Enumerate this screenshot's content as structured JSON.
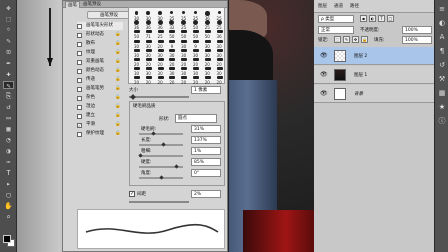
{
  "toolbar": {
    "tools": [
      "move-tool",
      "marquee-tool",
      "lasso-tool",
      "quick-select-tool",
      "crop-tool",
      "eyedropper-tool",
      "healing-tool",
      "brush-tool",
      "clone-stamp-tool",
      "history-brush-tool",
      "eraser-tool",
      "gradient-tool",
      "blur-tool",
      "dodge-tool",
      "pen-tool",
      "type-tool",
      "path-select-tool",
      "shape-tool",
      "hand-tool",
      "zoom-tool"
    ],
    "glyphs": [
      "✥",
      "⬚",
      "ᛜ",
      "✎",
      "⊡",
      "✒",
      "✚",
      "✎",
      "⎘",
      "↺",
      "▭",
      "▦",
      "◔",
      "◑",
      "✑",
      "T",
      "▸",
      "▢",
      "✋",
      "⌕"
    ],
    "active_index": 7
  },
  "brush_panel": {
    "tabs": [
      "画笔",
      "画笔预设"
    ],
    "presets_button": "画笔预设",
    "options": [
      {
        "label": "画笔笔尖形状",
        "checked": false,
        "lock": false
      },
      {
        "label": "形状动态",
        "checked": false,
        "lock": true
      },
      {
        "label": "散布",
        "checked": false,
        "lock": true
      },
      {
        "label": "纹理",
        "checked": false,
        "lock": true
      },
      {
        "label": "双重画笔",
        "checked": false,
        "lock": true
      },
      {
        "label": "颜色动态",
        "checked": false,
        "lock": true
      },
      {
        "label": "传递",
        "checked": false,
        "lock": true
      },
      {
        "label": "画笔笔势",
        "checked": false,
        "lock": true
      },
      {
        "label": "杂色",
        "checked": false,
        "lock": true
      },
      {
        "label": "湿边",
        "checked": false,
        "lock": true
      },
      {
        "label": "建立",
        "checked": false,
        "lock": true
      },
      {
        "label": "平滑",
        "checked": true,
        "lock": true
      },
      {
        "label": "保护纹理",
        "checked": false,
        "lock": true
      }
    ],
    "tip_sizes": [
      "30",
      "30",
      "30",
      "25",
      "25",
      "25",
      "36",
      "25",
      "36",
      "36",
      "36",
      "32",
      "25",
      "50",
      "25",
      "25",
      "50",
      "71",
      "25",
      "50",
      "50",
      "50",
      "50",
      "36",
      "30",
      "30",
      "20",
      "9",
      "30",
      "9",
      "30",
      "30",
      "30",
      "30",
      "30",
      "30",
      "30",
      "30",
      "30",
      "30",
      "20",
      "20",
      "20",
      "20",
      "20",
      "20",
      "20",
      "20",
      "30",
      "30",
      "30",
      "30",
      "30",
      "30",
      "30",
      "30",
      "20",
      "20",
      "20",
      "20",
      "20",
      "20",
      "20",
      "20"
    ],
    "size_label": "大小",
    "size_value": "1 像素",
    "dynamics_title": "硬毛刷品质",
    "shape_label": "形状:",
    "shape_value": "圆点",
    "params": [
      {
        "label": "硬毛刷:",
        "value": "31%",
        "fraction": 0.31
      },
      {
        "label": "长度:",
        "value": "137%",
        "fraction": 0.55
      },
      {
        "label": "粗细:",
        "value": "1%",
        "fraction": 0.01
      },
      {
        "label": "硬度:",
        "value": "85%",
        "fraction": 0.85
      },
      {
        "label": "角度:",
        "value": "0°",
        "fraction": 0.5
      }
    ],
    "spacing_label": "间距",
    "spacing_value": "2%",
    "spacing_checked": true
  },
  "layers_panel": {
    "header_items": [
      "图层",
      "通道",
      "路径"
    ],
    "kind_label": "ρ 类型",
    "blend_mode": "正常",
    "opacity_label": "不透明度:",
    "opacity_value": "100%",
    "lock_label": "锁定:",
    "fill_label": "填充:",
    "fill_value": "100%",
    "layers": [
      {
        "name": "图层 2",
        "selected": true
      },
      {
        "name": "图层 1",
        "selected": false
      },
      {
        "name": "背景",
        "selected": false,
        "italic": true
      }
    ]
  },
  "colors": {
    "panel_bg": "#d4d4d4",
    "toolbar_bg": "#4e4e4e",
    "selection": "#a9c5ea"
  }
}
